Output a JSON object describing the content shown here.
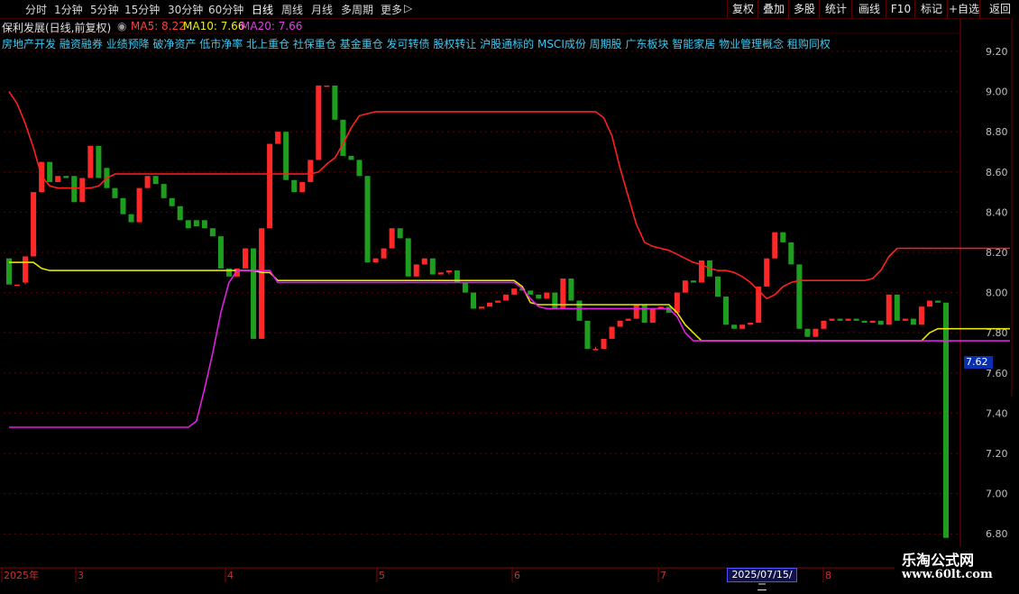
{
  "period_tabs": [
    "分时",
    "1分钟",
    "5分钟",
    "15分钟",
    "30分钟",
    "60分钟",
    "日线",
    "周线",
    "月线",
    "多周期",
    "更多"
  ],
  "active_tab": "日线",
  "more_arrow": "▷",
  "right_buttons": [
    "复权",
    "叠加",
    "多股",
    "统计",
    "画线",
    "F10",
    "标记",
    "+自选",
    "返回"
  ],
  "title": {
    "stock": "保利发展(日线,前复权)",
    "ma5_label": "MA5: 8.22",
    "ma10_label": "MA10: 7.66",
    "ma20_label": "MA20: 7.66"
  },
  "concepts": "房地产开发 融资融券 业绩预降 破净资产 低市净率 北上重仓 社保重仓 基金重仓 发可转债 股权转让 沪股通标的 MSCI成份 周期股 广东板块 智能家居 物业管理概念 租购同权",
  "last_price_tag": "7.62",
  "date_cursor": "2025/07/15/二",
  "watermark": {
    "line1": "乐淘公式网",
    "line2": "www.60lt.com"
  },
  "colors": {
    "up": "#ff2828",
    "down": "#1e9e1e",
    "line_red": "#ff2020",
    "line_yellow": "#e6e600",
    "line_magenta": "#e020e0",
    "grid": "#6a0000",
    "axis_text": "#c0c0c0"
  },
  "chart_data": {
    "type": "candlestick",
    "ylim": [
      6.75,
      9.35
    ],
    "y_ticks": [
      "9.20",
      "9.00",
      "8.80",
      "8.60",
      "8.40",
      "8.20",
      "8.00",
      "7.80",
      "7.60",
      "7.40",
      "7.20",
      "7.00",
      "6.80"
    ],
    "x_labels": [
      "2025年",
      "3",
      "4",
      "5",
      "6",
      "7",
      "8"
    ],
    "candles": [
      [
        8.17,
        8.04,
        8.17,
        8.04
      ],
      [
        8.04,
        8.04,
        8.04,
        8.04
      ],
      [
        8.05,
        8.18,
        8.18,
        8.04
      ],
      [
        8.18,
        8.5,
        8.5,
        8.18
      ],
      [
        8.5,
        8.65,
        8.65,
        8.5
      ],
      [
        8.65,
        8.55,
        8.65,
        8.55
      ],
      [
        8.55,
        8.58,
        8.58,
        8.55
      ],
      [
        8.58,
        8.57,
        8.58,
        8.57
      ],
      [
        8.58,
        8.45,
        8.58,
        8.45
      ],
      [
        8.45,
        8.57,
        8.57,
        8.45
      ],
      [
        8.57,
        8.73,
        8.73,
        8.57
      ],
      [
        8.73,
        8.57,
        8.73,
        8.57
      ],
      [
        8.62,
        8.52,
        8.62,
        8.52
      ],
      [
        8.52,
        8.47,
        8.52,
        8.47
      ],
      [
        8.47,
        8.39,
        8.47,
        8.39
      ],
      [
        8.39,
        8.35,
        8.39,
        8.35
      ],
      [
        8.35,
        8.52,
        8.52,
        8.35
      ],
      [
        8.52,
        8.58,
        8.58,
        8.52
      ],
      [
        8.58,
        8.54,
        8.58,
        8.54
      ],
      [
        8.54,
        8.47,
        8.54,
        8.47
      ],
      [
        8.47,
        8.43,
        8.47,
        8.43
      ],
      [
        8.43,
        8.36,
        8.43,
        8.36
      ],
      [
        8.36,
        8.32,
        8.36,
        8.32
      ],
      [
        8.36,
        8.33,
        8.36,
        8.33
      ],
      [
        8.36,
        8.32,
        8.36,
        8.32
      ],
      [
        8.32,
        8.28,
        8.32,
        8.28
      ],
      [
        8.28,
        8.12,
        8.28,
        8.12
      ],
      [
        8.12,
        8.08,
        8.12,
        8.08
      ],
      [
        8.08,
        8.12,
        8.12,
        8.08
      ],
      [
        8.12,
        8.22,
        8.22,
        8.12
      ],
      [
        8.22,
        7.77,
        8.22,
        7.77
      ],
      [
        7.77,
        8.32,
        8.32,
        7.77
      ],
      [
        8.32,
        8.74,
        8.74,
        8.32
      ],
      [
        8.74,
        8.8,
        8.8,
        8.74
      ],
      [
        8.8,
        8.56,
        8.8,
        8.56
      ],
      [
        8.56,
        8.5,
        8.56,
        8.5
      ],
      [
        8.5,
        8.55,
        8.55,
        8.5
      ],
      [
        8.55,
        8.66,
        8.66,
        8.55
      ],
      [
        8.66,
        9.03,
        9.03,
        8.66
      ],
      [
        9.03,
        9.03,
        9.03,
        9.03
      ],
      [
        9.03,
        8.86,
        9.03,
        8.86
      ],
      [
        8.86,
        8.68,
        8.86,
        8.68
      ],
      [
        8.68,
        8.66,
        8.68,
        8.66
      ],
      [
        8.66,
        8.58,
        8.66,
        8.58
      ],
      [
        8.58,
        8.15,
        8.58,
        8.15
      ],
      [
        8.15,
        8.17,
        8.17,
        8.15
      ],
      [
        8.17,
        8.22,
        8.22,
        8.17
      ],
      [
        8.22,
        8.32,
        8.32,
        8.22
      ],
      [
        8.32,
        8.27,
        8.32,
        8.27
      ],
      [
        8.27,
        8.08,
        8.27,
        8.08
      ],
      [
        8.08,
        8.14,
        8.14,
        8.08
      ],
      [
        8.14,
        8.17,
        8.17,
        8.14
      ],
      [
        8.17,
        8.09,
        8.17,
        8.09
      ],
      [
        8.09,
        8.1,
        8.1,
        8.09
      ],
      [
        8.1,
        8.11,
        8.11,
        8.09
      ],
      [
        8.11,
        8.05,
        8.11,
        8.05
      ],
      [
        8.05,
        8.0,
        8.05,
        8.0
      ],
      [
        8.0,
        7.92,
        8.0,
        7.92
      ],
      [
        7.92,
        7.93,
        7.93,
        7.92
      ],
      [
        7.93,
        7.95,
        7.95,
        7.93
      ],
      [
        7.95,
        7.96,
        7.96,
        7.95
      ],
      [
        7.96,
        7.99,
        7.99,
        7.96
      ],
      [
        7.99,
        8.02,
        8.02,
        7.99
      ],
      [
        8.02,
        8.01,
        8.02,
        8.01
      ],
      [
        8.01,
        7.99,
        8.01,
        7.99
      ],
      [
        7.99,
        7.97,
        7.99,
        7.97
      ],
      [
        7.97,
        8.0,
        8.0,
        7.97
      ],
      [
        8.0,
        7.92,
        8.0,
        7.92
      ],
      [
        7.92,
        8.07,
        8.07,
        7.92
      ],
      [
        8.07,
        7.96,
        8.07,
        7.96
      ],
      [
        7.96,
        7.86,
        7.96,
        7.86
      ],
      [
        7.86,
        7.72,
        7.86,
        7.72
      ],
      [
        7.72,
        7.72,
        7.73,
        7.72
      ],
      [
        7.72,
        7.77,
        7.77,
        7.72
      ],
      [
        7.77,
        7.83,
        7.83,
        7.77
      ],
      [
        7.83,
        7.86,
        7.86,
        7.83
      ],
      [
        7.86,
        7.87,
        7.87,
        7.86
      ],
      [
        7.87,
        7.94,
        7.94,
        7.87
      ],
      [
        7.94,
        7.85,
        7.94,
        7.85
      ],
      [
        7.85,
        7.92,
        7.92,
        7.85
      ],
      [
        7.92,
        7.93,
        7.93,
        7.92
      ],
      [
        7.93,
        7.9,
        7.93,
        7.9
      ],
      [
        7.9,
        8.0,
        8.0,
        7.9
      ],
      [
        8.0,
        8.06,
        8.06,
        8.0
      ],
      [
        8.06,
        8.05,
        8.06,
        8.05
      ],
      [
        8.05,
        8.16,
        8.16,
        8.05
      ],
      [
        8.16,
        8.08,
        8.16,
        8.08
      ],
      [
        8.08,
        7.98,
        8.08,
        7.98
      ],
      [
        7.98,
        7.84,
        7.98,
        7.84
      ],
      [
        7.84,
        7.82,
        7.84,
        7.82
      ],
      [
        7.82,
        7.84,
        7.84,
        7.82
      ],
      [
        7.84,
        7.85,
        7.85,
        7.84
      ],
      [
        7.85,
        8.03,
        8.03,
        7.85
      ],
      [
        8.03,
        8.17,
        8.17,
        8.03
      ],
      [
        8.17,
        8.3,
        8.3,
        8.17
      ],
      [
        8.3,
        8.25,
        8.3,
        8.25
      ],
      [
        8.25,
        8.14,
        8.25,
        8.14
      ],
      [
        8.14,
        7.82,
        8.14,
        7.82
      ],
      [
        7.82,
        7.78,
        7.82,
        7.78
      ],
      [
        7.78,
        7.82,
        7.82,
        7.78
      ],
      [
        7.82,
        7.86,
        7.86,
        7.82
      ],
      [
        7.86,
        7.87,
        7.87,
        7.86
      ],
      [
        7.87,
        7.86,
        7.87,
        7.86
      ],
      [
        7.86,
        7.87,
        7.87,
        7.86
      ],
      [
        7.87,
        7.86,
        7.87,
        7.86
      ],
      [
        7.86,
        7.85,
        7.86,
        7.85
      ],
      [
        7.85,
        7.86,
        7.86,
        7.85
      ],
      [
        7.86,
        7.84,
        7.86,
        7.84
      ],
      [
        7.84,
        7.99,
        7.99,
        7.84
      ],
      [
        7.99,
        7.86,
        7.99,
        7.86
      ],
      [
        7.86,
        7.87,
        7.87,
        7.86
      ],
      [
        7.87,
        7.84,
        7.87,
        7.84
      ],
      [
        7.84,
        7.93,
        7.93,
        7.84
      ],
      [
        7.93,
        7.96,
        7.96,
        7.93
      ],
      [
        7.96,
        7.95,
        7.96,
        7.95
      ],
      [
        7.95,
        6.78,
        7.95,
        6.78
      ]
    ],
    "series": [
      {
        "color": "#ff2020",
        "points": [
          [
            0,
            9.0
          ],
          [
            1,
            8.94
          ],
          [
            2,
            8.84
          ],
          [
            3,
            8.72
          ],
          [
            4,
            8.58
          ],
          [
            5,
            8.53
          ],
          [
            6,
            8.52
          ],
          [
            7,
            8.52
          ],
          [
            8,
            8.52
          ],
          [
            9,
            8.52
          ],
          [
            10,
            8.52
          ],
          [
            11,
            8.53
          ],
          [
            12,
            8.57
          ],
          [
            13,
            8.59
          ],
          [
            14,
            8.59
          ],
          [
            15,
            8.59
          ],
          [
            36,
            8.59
          ],
          [
            37,
            8.59
          ],
          [
            38,
            8.6
          ],
          [
            39,
            8.64
          ],
          [
            40,
            8.67
          ],
          [
            41,
            8.74
          ],
          [
            42,
            8.82
          ],
          [
            43,
            8.88
          ],
          [
            44,
            8.89
          ],
          [
            45,
            8.9
          ],
          [
            72,
            8.9
          ],
          [
            73,
            8.87
          ],
          [
            74,
            8.78
          ],
          [
            75,
            8.62
          ],
          [
            76,
            8.48
          ],
          [
            77,
            8.34
          ],
          [
            78,
            8.25
          ],
          [
            79,
            8.23
          ],
          [
            80,
            8.22
          ],
          [
            81,
            8.21
          ],
          [
            82,
            8.19
          ],
          [
            83,
            8.17
          ],
          [
            84,
            8.15
          ],
          [
            85,
            8.14
          ],
          [
            86,
            8.12
          ],
          [
            87,
            8.11
          ],
          [
            88,
            8.11
          ],
          [
            89,
            8.1
          ],
          [
            90,
            8.08
          ],
          [
            91,
            8.05
          ],
          [
            92,
            8.01
          ],
          [
            93,
            7.97
          ],
          [
            94,
            7.99
          ],
          [
            95,
            8.03
          ],
          [
            96,
            8.05
          ],
          [
            97,
            8.06
          ],
          [
            105,
            8.06
          ],
          [
            106,
            8.07
          ],
          [
            107,
            8.11
          ],
          [
            108,
            8.18
          ],
          [
            109,
            8.22
          ],
          [
            110,
            8.22
          ],
          [
            125,
            8.22
          ]
        ]
      },
      {
        "color": "#e6e600",
        "points": [
          [
            0,
            8.15
          ],
          [
            3,
            8.15
          ],
          [
            4,
            8.12
          ],
          [
            5,
            8.11
          ],
          [
            29,
            8.11
          ],
          [
            30,
            8.11
          ],
          [
            31,
            8.1
          ],
          [
            32,
            8.1
          ],
          [
            33,
            8.06
          ],
          [
            34,
            8.06
          ],
          [
            62,
            8.06
          ],
          [
            63,
            8.03
          ],
          [
            64,
            7.95
          ],
          [
            65,
            7.94
          ],
          [
            81,
            7.94
          ],
          [
            82,
            7.9
          ],
          [
            83,
            7.84
          ],
          [
            84,
            7.8
          ],
          [
            85,
            7.76
          ],
          [
            86,
            7.76
          ],
          [
            111,
            7.76
          ],
          [
            112,
            7.76
          ],
          [
            113,
            7.8
          ],
          [
            114,
            7.82
          ],
          [
            124,
            7.82
          ],
          [
            125,
            7.66
          ]
        ]
      },
      {
        "color": "#e020e0",
        "points": [
          [
            0,
            7.33
          ],
          [
            22,
            7.33
          ],
          [
            23,
            7.36
          ],
          [
            24,
            7.52
          ],
          [
            25,
            7.7
          ],
          [
            26,
            7.9
          ],
          [
            27,
            8.05
          ],
          [
            28,
            8.11
          ],
          [
            32,
            8.11
          ],
          [
            33,
            8.05
          ],
          [
            62,
            8.05
          ],
          [
            63,
            8.02
          ],
          [
            64,
            7.97
          ],
          [
            65,
            7.93
          ],
          [
            66,
            7.92
          ],
          [
            81,
            7.92
          ],
          [
            82,
            7.88
          ],
          [
            83,
            7.8
          ],
          [
            84,
            7.76
          ],
          [
            125,
            7.76
          ],
          [
            126,
            7.66
          ]
        ]
      }
    ]
  }
}
